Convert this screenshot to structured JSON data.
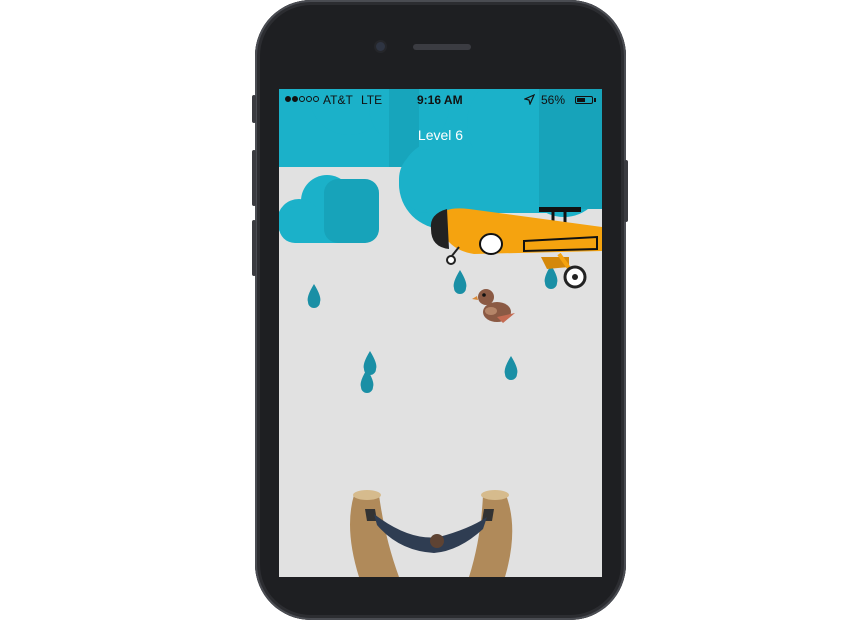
{
  "status_bar": {
    "signal_bars_filled": 2,
    "signal_bars_total": 5,
    "carrier": "AT&T",
    "network": "LTE",
    "time": "9:16 AM",
    "battery": "56%",
    "battery_level": 0.56
  },
  "game": {
    "level_label": "Level 6"
  },
  "colors": {
    "sky": "#e1e1e1",
    "cloud": "#1bb1c9",
    "raindrop": "#1a8fa5",
    "plane_body": "#f5a30f",
    "bird": "#8b5a44",
    "slingshot_wood": "#b08a5a",
    "sling_pouch": "#2f3d52"
  },
  "icons": [
    "location-arrow-icon",
    "battery-icon",
    "signal-dots-icon"
  ]
}
